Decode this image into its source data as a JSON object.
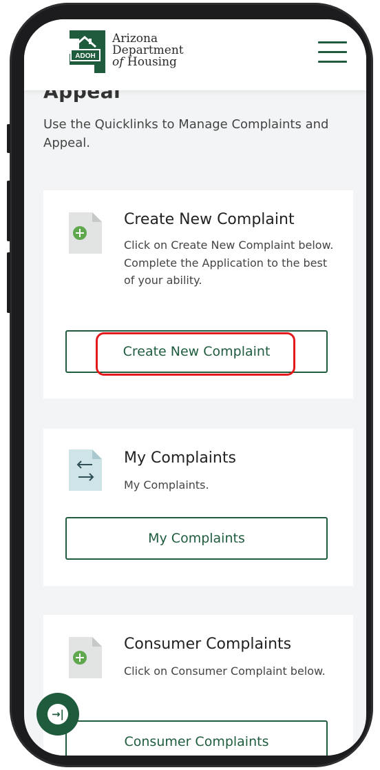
{
  "header": {
    "logo_badge": "ADOH",
    "logo_line1": "Arizona",
    "logo_line2": "Department",
    "logo_line3_italic": "of",
    "logo_line3_rest": " Housing",
    "menu_icon": "hamburger-menu-icon"
  },
  "page": {
    "title": "Appeal",
    "intro": "Use the Quicklinks to Manage Complaints and Appeal."
  },
  "cards": [
    {
      "icon": "document-add-icon",
      "title": "Create New Complaint",
      "description": "Click on Create New Complaint below. Complete the Application to the best of your ability.",
      "button": "Create New Complaint",
      "highlighted": true
    },
    {
      "icon": "document-transfer-icon",
      "title": "My Complaints",
      "description": "My Complaints.",
      "button": "My Complaints"
    },
    {
      "icon": "document-add-icon",
      "title": "Consumer Complaints",
      "description": "Click on Consumer Complaint below.",
      "button": "Consumer Complaints"
    }
  ],
  "floating": {
    "icon": "expand-sidebar-icon",
    "glyph": "→|"
  },
  "colors": {
    "brand_green": "#1f5c3e",
    "highlight_red": "#e3191b",
    "page_bg": "#f2f4f5"
  }
}
